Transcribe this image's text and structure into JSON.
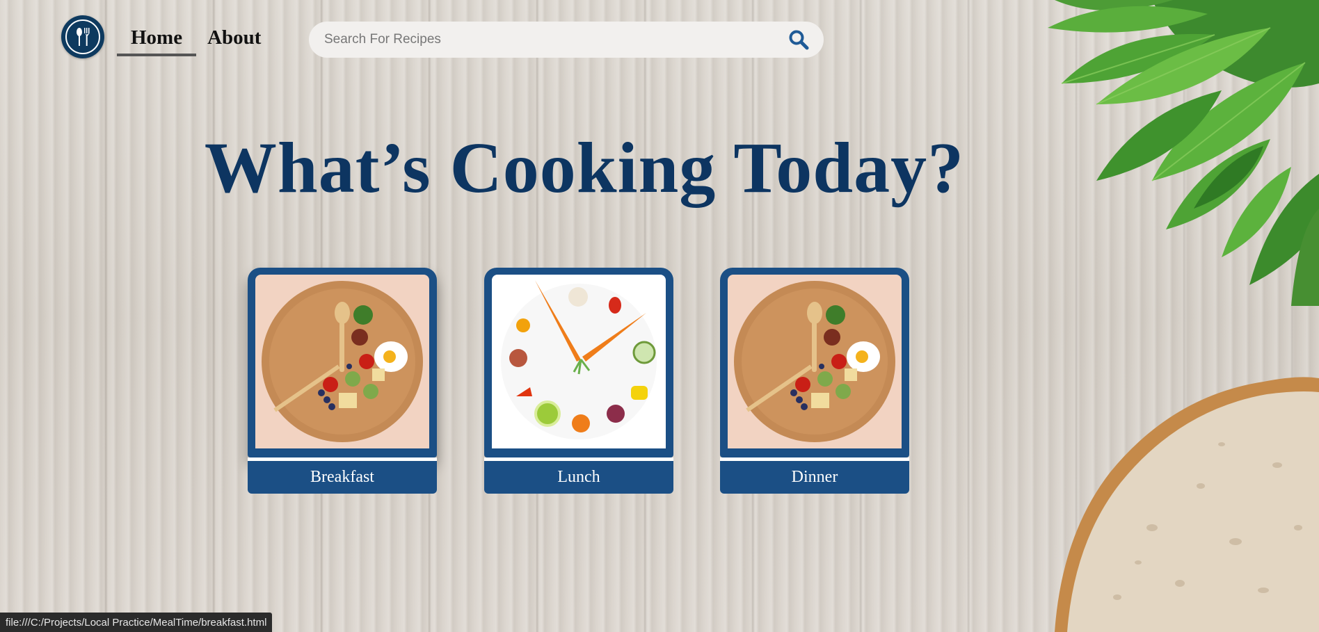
{
  "header": {
    "logo_icon": "fork-spoon-icon",
    "nav": [
      {
        "label": "Home",
        "active": true
      },
      {
        "label": "About",
        "active": false
      }
    ],
    "search": {
      "placeholder": "Search For Recipes",
      "value": "",
      "icon": "search-icon"
    }
  },
  "headline": "What’s Cooking Today?",
  "cards": [
    {
      "label": "Breakfast",
      "image": "plate-clock-breakfast"
    },
    {
      "label": "Lunch",
      "image": "vegetable-clock-lunch"
    },
    {
      "label": "Dinner",
      "image": "plate-clock-dinner"
    }
  ],
  "status_bar": {
    "url": "file:///C:/Projects/Local Practice/MealTime/breakfast.html"
  },
  "colors": {
    "navy": "#0d3561",
    "card_blue": "#1b4f85",
    "search_icon": "#1f5a96"
  }
}
